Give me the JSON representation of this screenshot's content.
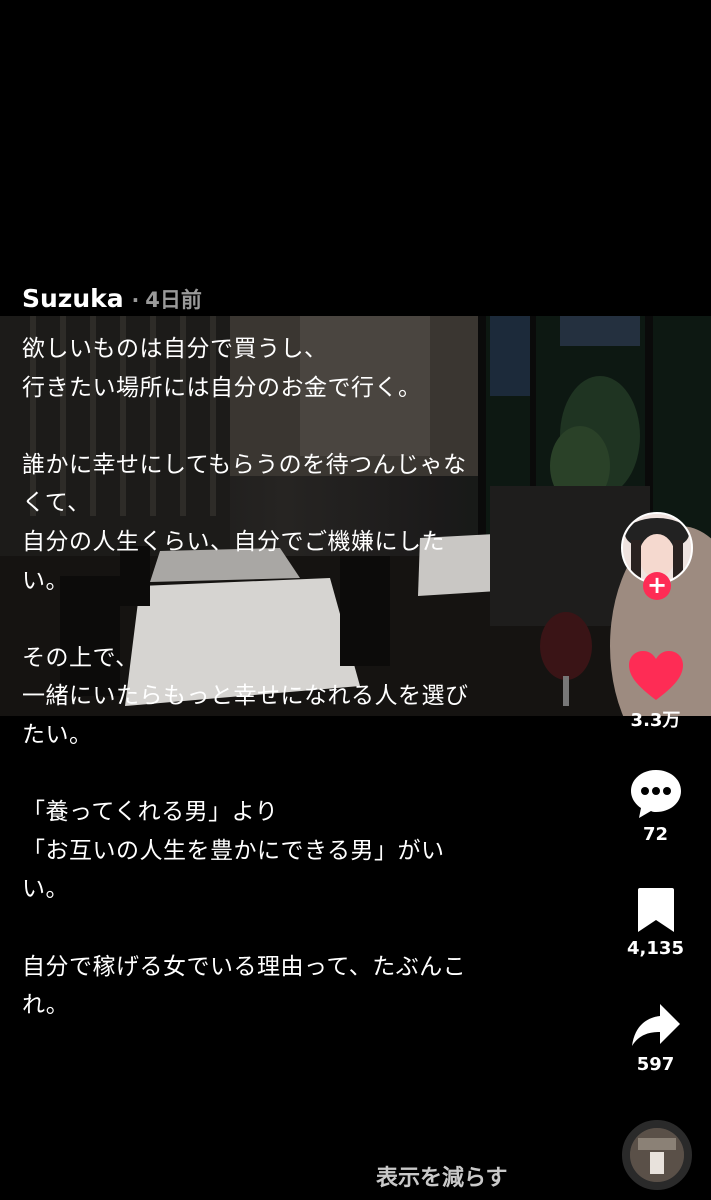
{
  "post": {
    "author": "Suzuka",
    "separator": "·",
    "time": "4日前",
    "caption": "欲しいものは自分で買うし、\n行きたい場所には自分のお金で行く。\n\n誰かに幸せにしてもらうのを待つんじゃな\nくて、\n自分の人生くらい、自分でご機嫌にした\nい。\n\nその上で、\n一緒にいたらもっと幸せになれる人を選び\nたい。\n\n「養ってくれる男」より\n「お互いの人生を豊かにできる男」がい\nい。\n\n自分で稼げる女でいる理由って、たぶんこ\nれ。",
    "show_less": "表示を減らす"
  },
  "actions": {
    "follow_symbol": "+",
    "likes": "3.3万",
    "comments": "72",
    "bookmarks": "4,135",
    "shares": "597"
  },
  "colors": {
    "like_red": "#fe2c55",
    "follow_red": "#fe2c55",
    "meta_gray": "#9a9a9a"
  },
  "icons": [
    "heart-icon",
    "comment-bubble-icon",
    "bookmark-icon",
    "share-arrow-icon",
    "plus-icon"
  ]
}
